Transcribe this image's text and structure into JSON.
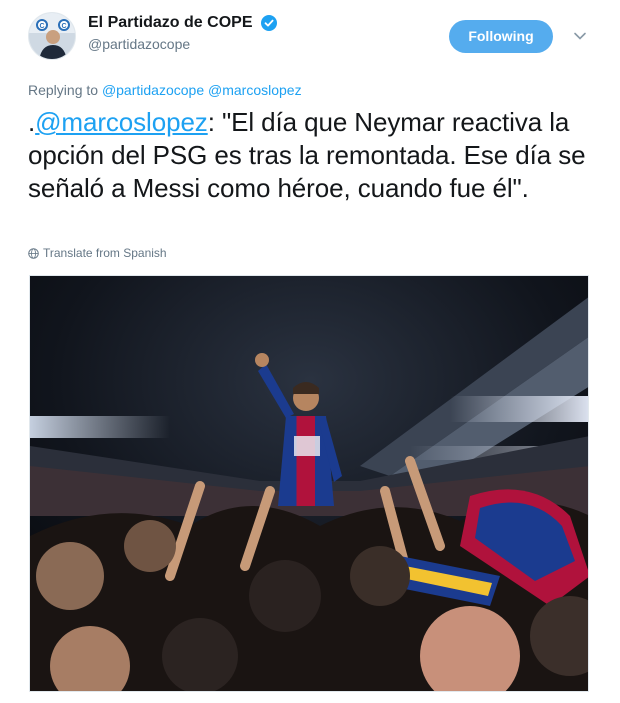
{
  "account": {
    "display_name": "El Partidazo de COPE",
    "handle": "@partidazocope",
    "verified": true,
    "avatar_icon": "avatar-photo-icon"
  },
  "actions": {
    "follow_label": "Following",
    "caret_icon": "chevron-down-icon"
  },
  "reply_context": {
    "prefix": "Replying to",
    "users": [
      "@partidazocope",
      "@marcoslopez"
    ]
  },
  "tweet": {
    "lead": ".",
    "mention": "@marcoslopez",
    "body": ": \"El día que Neymar reactiva la opción del PSG es tras la remontada. Ese día se señaló a Messi como héroe, cuando fue él\"."
  },
  "translate": {
    "icon": "globe-icon",
    "label": "Translate from Spanish"
  },
  "media": {
    "kind": "photo",
    "icon": "football-celebration-photo"
  },
  "colors": {
    "accent": "#1da1f2",
    "follow_button": "#55acee",
    "muted": "#657786",
    "text": "#14171a"
  }
}
